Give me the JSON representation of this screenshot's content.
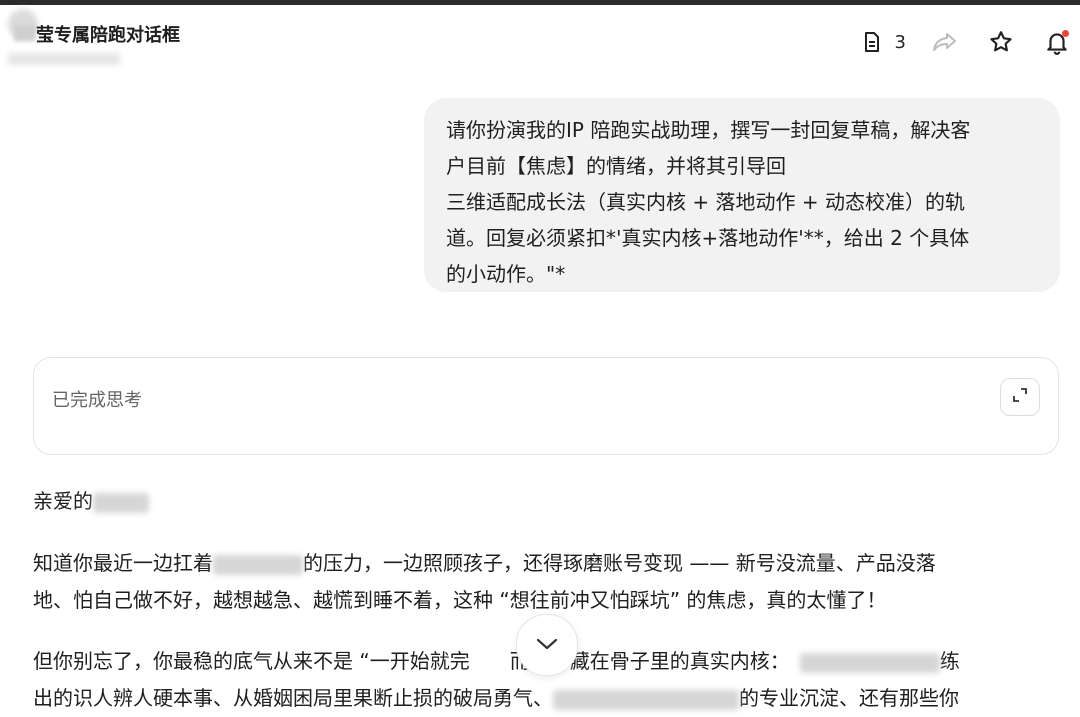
{
  "header": {
    "title": "莹专属陪跑对话框",
    "doc_count": "3",
    "icons": [
      "document-icon",
      "share-icon",
      "star-icon",
      "bell-icon"
    ],
    "notification_dot_color": "#f0413b"
  },
  "user_message": {
    "lines": [
      "请你扮演我的IP 陪跑实战助理，撰写一封回复草稿，解决客",
      "户目前【焦虑】的情绪，并将其引导回",
      "三维适配成长法（真实内核 + 落地动作 + 动态校准）的轨",
      "道。回复必须紧扣*'真实内核+落地动作'**，给出 2 个具体",
      "的小动作。\"*"
    ]
  },
  "thinking": {
    "label": "已完成思考",
    "expand_icon": "expand-icon"
  },
  "reply": {
    "greeting": "亲爱的",
    "p1_line1_a": "知道你最近一边扛着",
    "p1_line1_b": "的压力，一边照顾孩子，还得琢磨账号变现 —— 新号没流量、产品没落",
    "p1_line2": "地、怕自己做不好，越想越急、越慌到睡不着，这种 “想往前冲又怕踩坑” 的焦虑，真的太懂了！",
    "p2_line1_a": "但你别忘了，你最稳的底气从来不是 “一开始就完",
    "p2_line1_b": "而是你藏在骨子里的真实内核：",
    "p2_line1_c": "练",
    "p2_line2_a": "出的识人辨人硬本事、从婚姻困局里果断止损的破局勇气、",
    "p2_line2_b": "的专业沉淀、还有那些你"
  },
  "scroll": {
    "icon": "chevron-down-icon"
  }
}
